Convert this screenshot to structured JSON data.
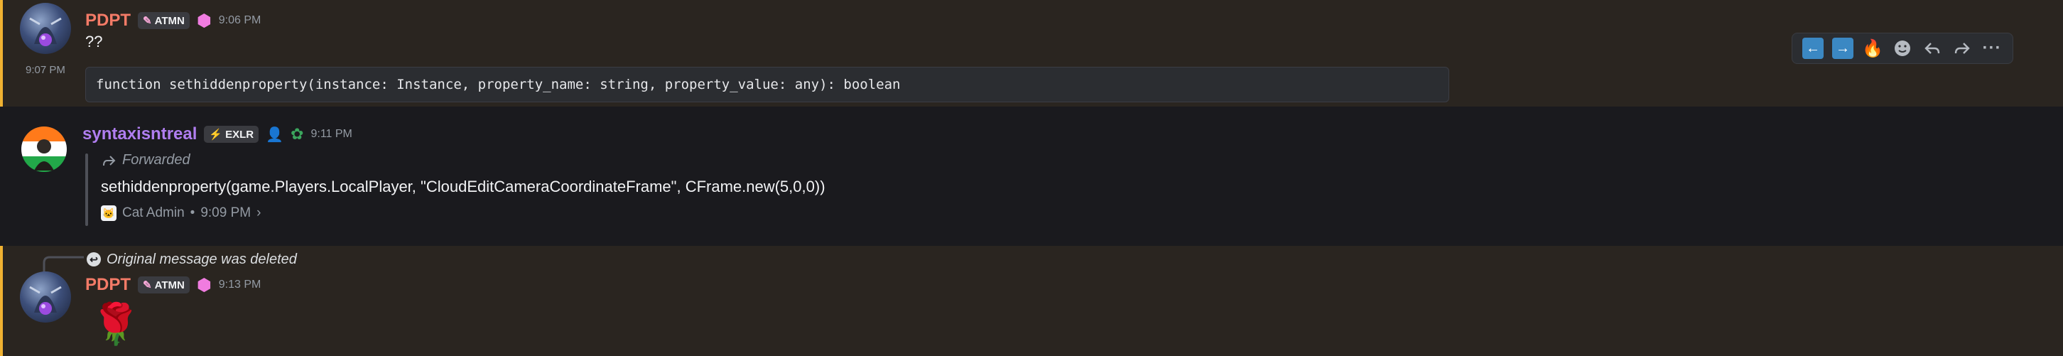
{
  "messages": {
    "first": {
      "author": "PDPT",
      "guild_tag": "ATMN",
      "time": "9:06 PM",
      "text": "??",
      "followup_time": "9:07 PM",
      "code": "function sethiddenproperty(instance: Instance, property_name: string, property_value: any): boolean"
    },
    "second": {
      "author": "syntaxisntreal",
      "guild_tag": "EXLR",
      "time": "9:11 PM",
      "forwarded_label": "Forwarded",
      "forwarded_text": "sethiddenproperty(game.Players.LocalPlayer, \"CloudEditCameraCoordinateFrame\",  CFrame.new(5,0,0))",
      "source_name": "Cat Admin",
      "source_sep": "•",
      "source_time": "9:09 PM",
      "source_chevron": "›"
    },
    "third": {
      "reply_notice": "Original message was deleted",
      "author": "PDPT",
      "guild_tag": "ATMN",
      "time": "9:13 PM",
      "emoji": "🌹"
    }
  },
  "toolbar": {
    "items": [
      "arrow-left-box",
      "arrow-right-box",
      "fire",
      "add-reaction",
      "reply",
      "forward",
      "more"
    ],
    "more_label": "···"
  },
  "colors": {
    "pdpt_name": "#f47b67",
    "synt_name": "#b07ef0",
    "highlight_border": "#f0b232",
    "highlight_bg": "#2a2520"
  }
}
